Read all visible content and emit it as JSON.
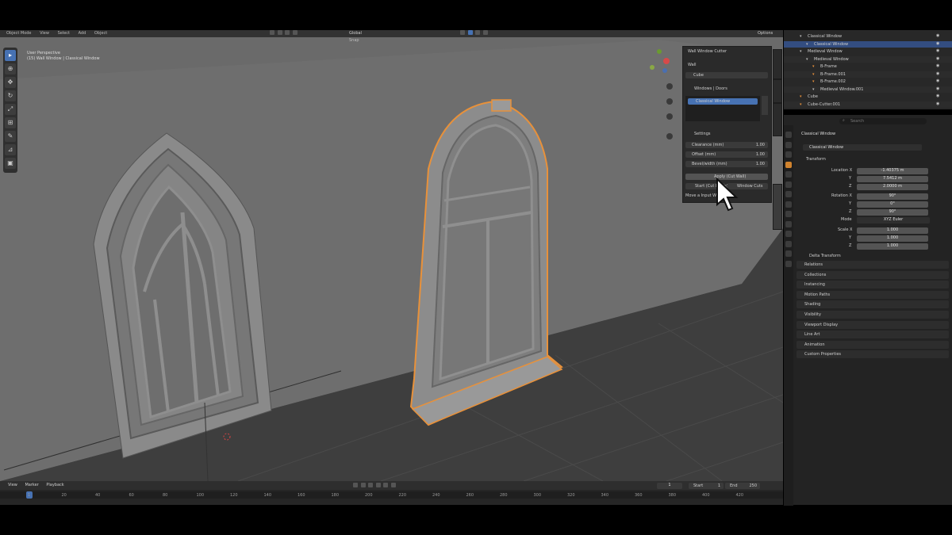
{
  "viewport": {
    "header_menu": [
      "Object Mode",
      "View",
      "Select",
      "Add",
      "Object"
    ],
    "transform_orientation": "Global",
    "snapping_label": "Snap",
    "overlay_text": [
      "User Perspective",
      "(15) Wall Window | Classical Window"
    ]
  },
  "toolbar": {
    "tools": [
      "select-box-icon",
      "cursor-icon",
      "move-icon",
      "rotate-icon",
      "scale-icon",
      "transform-icon",
      "annotate-icon",
      "measure-icon",
      "add-cube-icon"
    ]
  },
  "npanel": {
    "options_label": "Options",
    "header": "Wall Window Cutter",
    "wall_label": "Wall",
    "wall_value": "Cube",
    "windows_label": "Windows | Doors",
    "windows_selected": "Classical Window",
    "settings_label": "Settings",
    "fields": [
      {
        "label": "Clearance (mm)",
        "value": "1.00"
      },
      {
        "label": "Offset (mm)",
        "value": "1.00"
      },
      {
        "label": "Bevel/width (mm)",
        "value": "1.00"
      }
    ],
    "apply_button": "Apply (Cut Wall)",
    "sub_buttons": [
      "Start (Cut Holes)",
      "Window Cuts"
    ],
    "footer_text": "Move a Input Window"
  },
  "outliner": {
    "rows": [
      {
        "label": "Classical Window",
        "indent": 0
      },
      {
        "label": "Classical Window",
        "indent": 1,
        "selected": true
      },
      {
        "label": "Medieval Window",
        "indent": 0
      },
      {
        "label": "Medieval Window",
        "indent": 1
      },
      {
        "label": "B-Frame",
        "indent": 2
      },
      {
        "label": "B-Frame.001",
        "indent": 2
      },
      {
        "label": "B-Frame.002",
        "indent": 2
      },
      {
        "label": "Medieval Window.001",
        "indent": 2
      },
      {
        "label": "Cube",
        "indent": 0
      },
      {
        "label": "Cube-Cutter.001",
        "indent": 0
      }
    ]
  },
  "properties": {
    "search_placeholder": "Search",
    "object_title": "Classical Window",
    "object_name": "Classical Window",
    "transform_label": "Transform",
    "location_label": "Location X",
    "location": [
      "-1.40375 m",
      "7.5412 m",
      "2.0000 m"
    ],
    "rotation_label": "Rotation X",
    "rotation": [
      "90°",
      "0°",
      "90°"
    ],
    "mode_label": "Mode",
    "mode_value": "XYZ Euler",
    "scale_label": "Scale X",
    "scale": [
      "1.000",
      "1.000",
      "1.000"
    ],
    "axis_labels": [
      "Y",
      "Z"
    ],
    "delta_label": "Delta Transform",
    "sections": [
      "Relations",
      "Collections",
      "Instancing",
      "Motion Paths",
      "Shading",
      "Visibility",
      "Viewport Display",
      "Line Art",
      "Animation",
      "Custom Properties"
    ]
  },
  "timeline": {
    "menu": [
      "View",
      "Marker",
      "Playback"
    ],
    "current_frame": "1",
    "start_label": "Start",
    "start_value": "1",
    "end_label": "End",
    "end_value": "250",
    "ruler": [
      "1",
      "20",
      "40",
      "60",
      "80",
      "100",
      "120",
      "140",
      "160",
      "180",
      "200",
      "220",
      "240",
      "260",
      "280",
      "300",
      "320",
      "340",
      "360",
      "380",
      "400",
      "420"
    ]
  },
  "colors": {
    "selection_outline": "#e8913a",
    "active_blue": "#4772b3"
  }
}
